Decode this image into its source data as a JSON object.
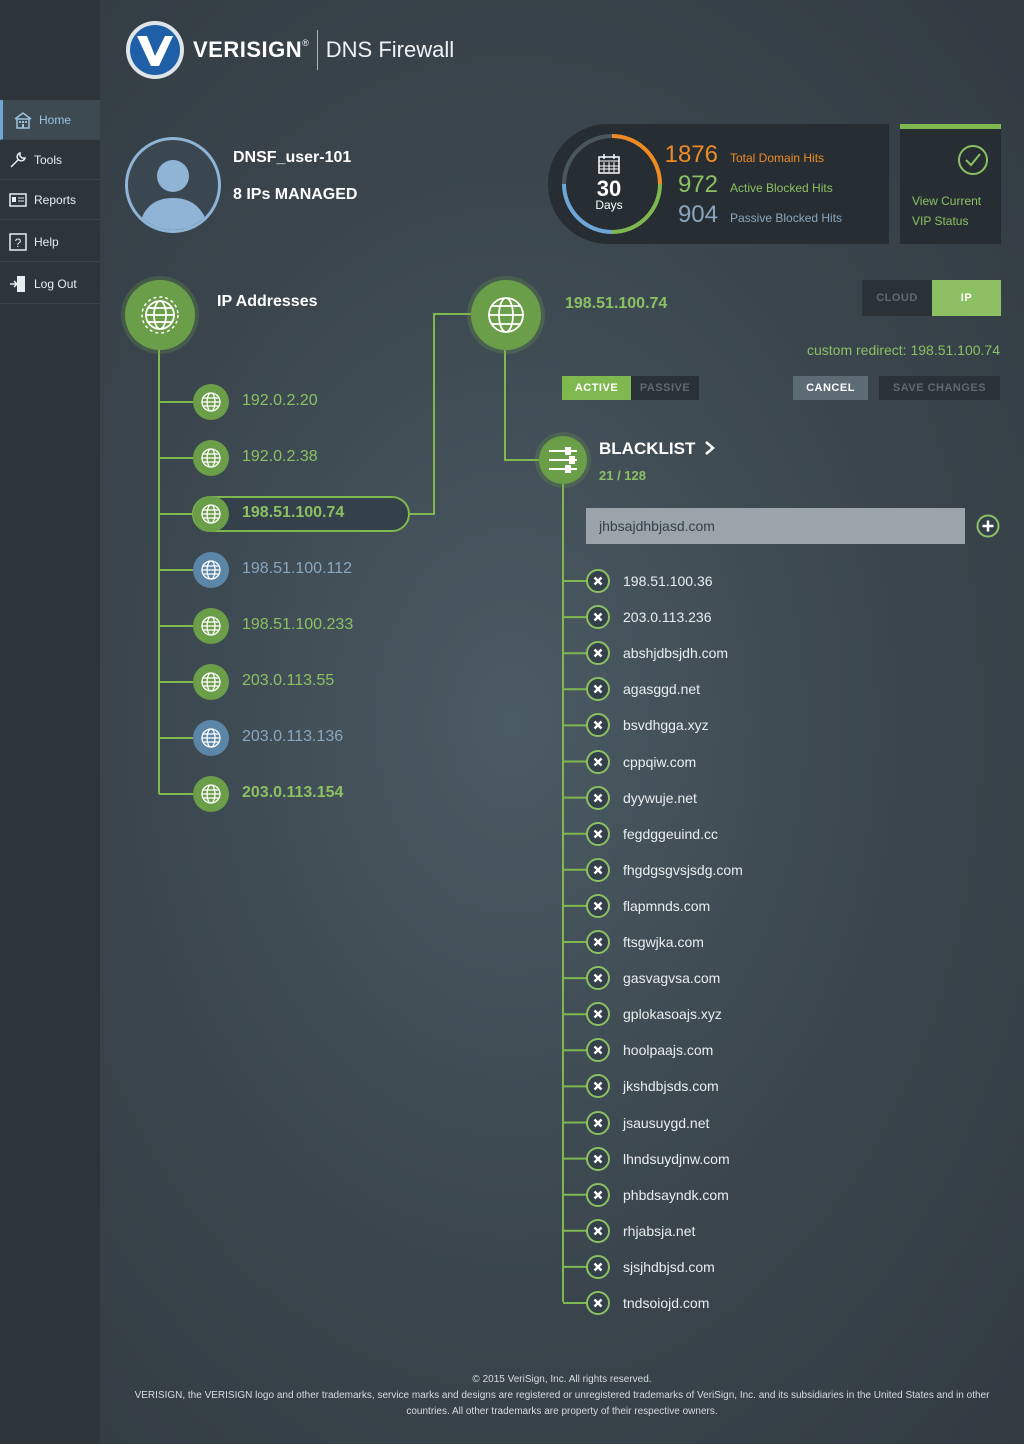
{
  "brand": {
    "name": "VERISIGN",
    "reg": "®",
    "product": "DNS Firewall"
  },
  "sidebar": {
    "items": [
      {
        "label": "Home",
        "icon": "home-icon",
        "active": true
      },
      {
        "label": "Tools",
        "icon": "wrench-icon",
        "active": false
      },
      {
        "label": "Reports",
        "icon": "reports-icon",
        "active": false
      },
      {
        "label": "Help",
        "icon": "help-icon",
        "active": false
      },
      {
        "label": "Log Out",
        "icon": "logout-icon",
        "active": false
      }
    ]
  },
  "user": {
    "name": "DNSF_user-101",
    "ips_managed": "8 IPs MANAGED"
  },
  "stats": {
    "days": "30",
    "days_label": "Days",
    "total_hits": "1876",
    "total_label": "Total Domain Hits",
    "active_hits": "972",
    "active_label": "Active Blocked Hits",
    "passive_hits": "904",
    "passive_label": "Passive Blocked Hits"
  },
  "vip": {
    "line1": "View Current",
    "line2": "VIP Status"
  },
  "ip_list": {
    "title": "IP Addresses",
    "items": [
      {
        "ip": "192.0.2.20",
        "status": "green"
      },
      {
        "ip": "192.0.2.38",
        "status": "green"
      },
      {
        "ip": "198.51.100.74",
        "status": "selected"
      },
      {
        "ip": "198.51.100.112",
        "status": "blue"
      },
      {
        "ip": "198.51.100.233",
        "status": "green"
      },
      {
        "ip": "203.0.113.55",
        "status": "green"
      },
      {
        "ip": "203.0.113.136",
        "status": "blue"
      },
      {
        "ip": "203.0.113.154",
        "status": "green-bold"
      }
    ]
  },
  "detail": {
    "ip": "198.51.100.74",
    "toggle": {
      "cloud": "CLOUD",
      "ip": "IP"
    },
    "redirect": "custom redirect: 198.51.100.74",
    "mode": {
      "active": "ACTIVE",
      "passive": "PASSIVE"
    },
    "cancel": "CANCEL",
    "save": "SAVE CHANGES"
  },
  "blacklist": {
    "title": "BLACKLIST",
    "count": "21 / 128",
    "input_value": "jhbsajdhbjasd.com",
    "items": [
      "198.51.100.36",
      "203.0.113.236",
      "abshjdbsjdh.com",
      "agasggd.net",
      "bsvdhgga.xyz",
      "cppqiw.com",
      "dyywuje.net",
      "fegdggeuind.cc",
      "fhgdgsgvsjsdg.com",
      "flapmnds.com",
      "ftsgwjka.com",
      "gasvagvsa.com",
      "gplokasoajs.xyz",
      "hoolpaajs.com",
      "jkshdbjsds.com",
      "jsausuygd.net",
      "lhndsuydjnw.com",
      "phbdsayndk.com",
      "rhjabsja.net",
      "sjsjhdbjsd.com",
      "tndsoiojd.com"
    ]
  },
  "footer": {
    "line1": "© 2015 VeriSign, Inc. All rights reserved.",
    "line2": "VERISIGN, the VERISIGN logo and other trademarks, service marks and designs are registered or unregistered trademarks of VeriSign, Inc. and its subsidiaries in the United States and in other countries. All other trademarks are property of their respective owners."
  },
  "colors": {
    "accent_green": "#8cc063",
    "orange": "#f08a24",
    "blue": "#6ea6d6",
    "sidebar": "#2d353b"
  }
}
